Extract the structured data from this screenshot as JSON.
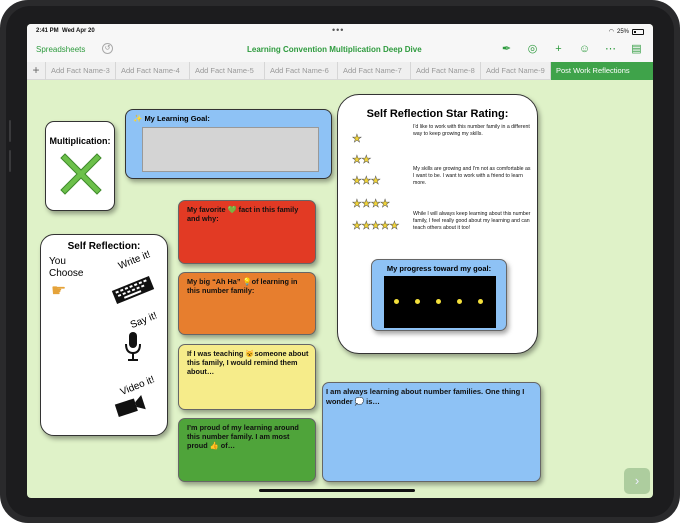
{
  "status_bar": {
    "time": "2:41 PM",
    "date": "Wed Apr 20",
    "battery": "25%"
  },
  "toolbar": {
    "back_label": "Spreadsheets",
    "doc_title": "Learning Convention Multiplication  Deep Dive",
    "tools": [
      {
        "name": "format-brush-icon",
        "glyph": "✒"
      },
      {
        "name": "comment-icon",
        "glyph": "◎"
      },
      {
        "name": "add-icon",
        "glyph": "+"
      },
      {
        "name": "collaborate-icon",
        "glyph": "☺"
      },
      {
        "name": "more-icon",
        "glyph": "⋯"
      },
      {
        "name": "document-icon",
        "glyph": "▤"
      }
    ]
  },
  "tabs": [
    {
      "label": "Add Fact Name-3",
      "active": false
    },
    {
      "label": "Add Fact Name-4",
      "active": false
    },
    {
      "label": "Add Fact Name-5",
      "active": false
    },
    {
      "label": "Add Fact Name-6",
      "active": false
    },
    {
      "label": "Add Fact Name-7",
      "active": false
    },
    {
      "label": "Add Fact Name-8",
      "active": false
    },
    {
      "label": "Add Fact Name-9",
      "active": false
    },
    {
      "label": "Post Work Reflections",
      "active": true
    }
  ],
  "multiplication": {
    "label": "Multiplication:"
  },
  "goal": {
    "label": "My Learning Goal:"
  },
  "self_reflection": {
    "label": "Self Reflection:",
    "you_choose": "You Choose",
    "options": [
      "Write it!",
      "Say it!",
      "Video it!"
    ]
  },
  "prompts": {
    "favorite": "My favorite 💚 fact in this family and why:",
    "ahha": "My big “Ah Ha” 💡of learning in this number family:",
    "teach": "If I was teaching 😺someone about this family, I would remind them about…",
    "proud": "I’m proud of my learning around this number family.  I am most proud 👍 of…",
    "wonder": "I am always learning about number families. One thing I wonder 💭 is…"
  },
  "rating": {
    "title": "Self Reflection Star Rating:",
    "rows": [
      {
        "stars": 1,
        "text": "I'd like to work with this number family in a different way to keep growing my skills."
      },
      {
        "stars": 2,
        "text": ""
      },
      {
        "stars": 3,
        "text": "My skills are growing and I'm not as comfortable as I want to be.  I want to work with a friend to learn more."
      },
      {
        "stars": 4,
        "text": ""
      },
      {
        "stars": 5,
        "text": "While I will always keep learning about this number family, I feel really good about my learning and can teach others about it too!"
      }
    ]
  },
  "progress": {
    "label": "My progress toward my goal:",
    "dots": 5
  },
  "colors": {
    "accent": "#3fa34a",
    "canvas": "#dff2c8",
    "blue": "#8ec2f5",
    "red": "#e23a24",
    "orange": "#e77e2e",
    "yellow": "#f6ec8a",
    "green": "#4fa43a"
  }
}
